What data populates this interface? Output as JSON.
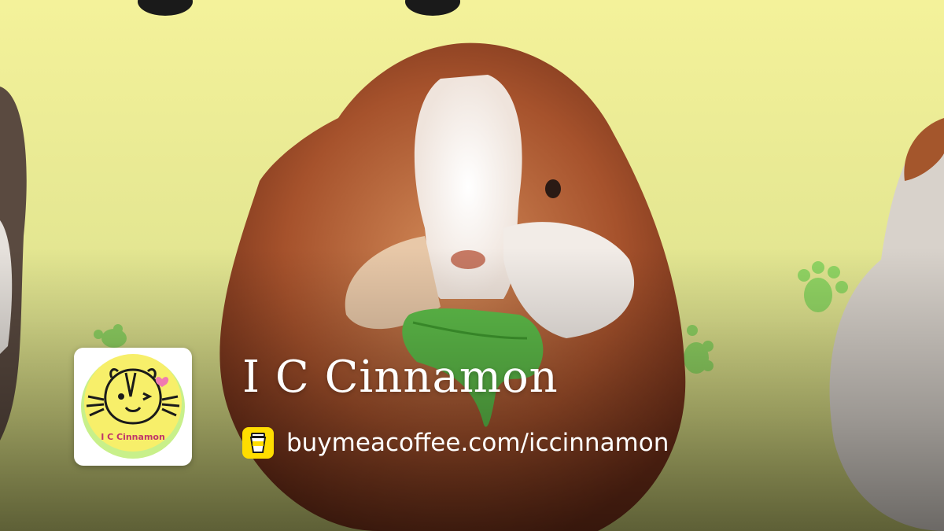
{
  "profile": {
    "name": "I C Cinnamon",
    "url": "buymeacoffee.com/iccinnamon",
    "avatar_caption": "I C Cinnamon"
  },
  "icons": {
    "link_icon": "coffee-cup-icon",
    "avatar_icon": "guinea-pig-logo-icon"
  },
  "colors": {
    "background": "#e9ec99",
    "accent": "#ffdd00",
    "text": "#ffffff"
  }
}
